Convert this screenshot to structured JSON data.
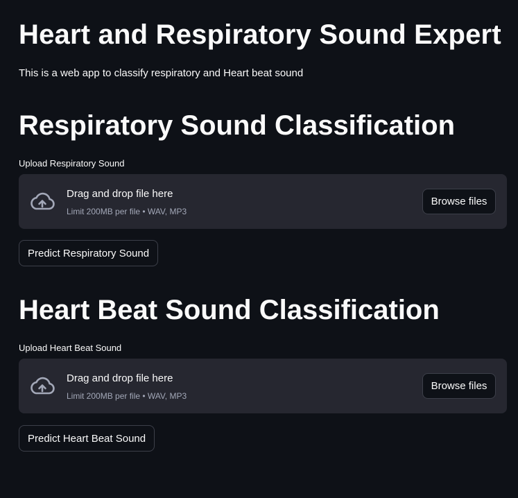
{
  "header": {
    "title": "Heart and Respiratory Sound Expert",
    "description": "This is a web app to classify respiratory and Heart beat sound"
  },
  "respiratory": {
    "section_title": "Respiratory Sound Classification",
    "upload_label": "Upload Respiratory Sound",
    "dropzone": {
      "instruction": "Drag and drop file here",
      "limit": "Limit 200MB per file • WAV, MP3",
      "icon": "cloud-upload-icon",
      "browse_label": "Browse files"
    },
    "predict_label": "Predict Respiratory Sound"
  },
  "heartbeat": {
    "section_title": "Heart Beat Sound Classification",
    "upload_label": "Upload Heart Beat Sound",
    "dropzone": {
      "instruction": "Drag and drop file here",
      "limit": "Limit 200MB per file • WAV, MP3",
      "icon": "cloud-upload-icon",
      "browse_label": "Browse files"
    },
    "predict_label": "Predict Heart Beat Sound"
  },
  "colors": {
    "background": "#0e1117",
    "dropzone_bg": "#262730",
    "text": "#fafafa",
    "muted_text": "#a3a8b8",
    "button_border": "#3d404a"
  }
}
